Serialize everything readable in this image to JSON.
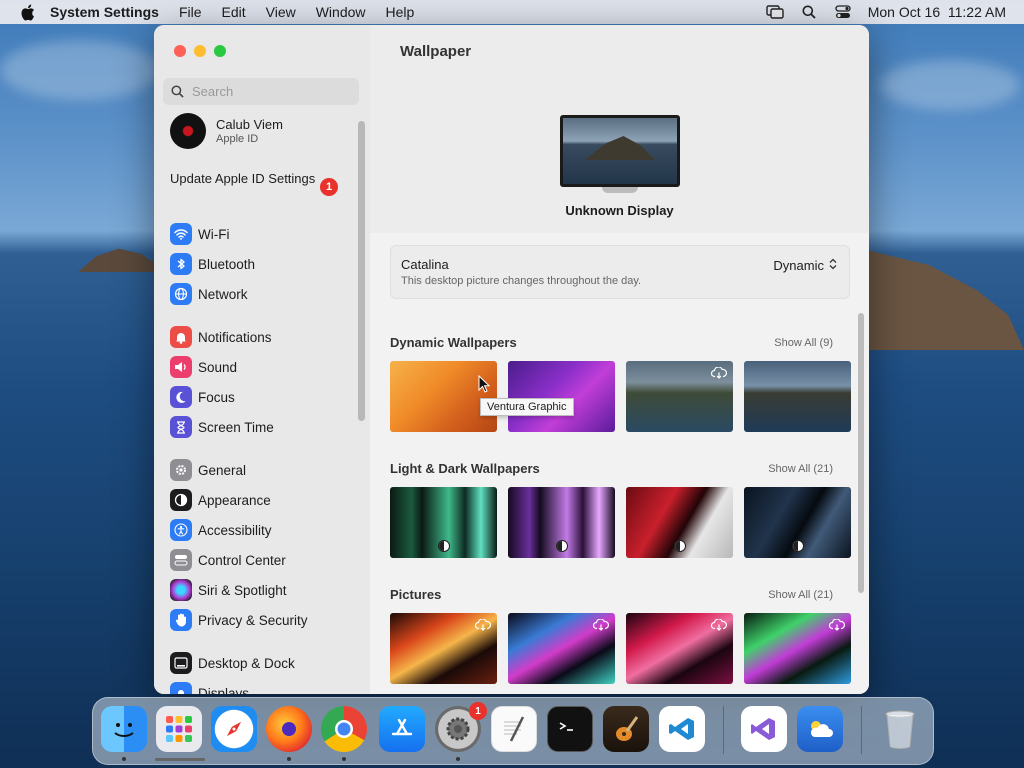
{
  "menubar": {
    "app_name": "System Settings",
    "menus": [
      "File",
      "Edit",
      "View",
      "Window",
      "Help"
    ],
    "datetime": "Mon Oct 16  11:22 AM"
  },
  "sidebar": {
    "search_placeholder": "Search",
    "account": {
      "name": "Calub Viem",
      "subtitle": "Apple ID"
    },
    "update": {
      "label": "Update Apple ID Settings",
      "badge": "1"
    },
    "items": [
      {
        "label": "Wi-Fi",
        "icon": "wifi-icon",
        "color": "#2d7cf6"
      },
      {
        "label": "Bluetooth",
        "icon": "bluetooth-icon",
        "color": "#2d7cf6"
      },
      {
        "label": "Network",
        "icon": "globe-icon",
        "color": "#2d7cf6"
      },
      {
        "label": "Notifications",
        "icon": "bell-icon",
        "color": "#ec4d47"
      },
      {
        "label": "Sound",
        "icon": "speaker-icon",
        "color": "#ec3e6d"
      },
      {
        "label": "Focus",
        "icon": "moon-icon",
        "color": "#5a52d6"
      },
      {
        "label": "Screen Time",
        "icon": "hourglass-icon",
        "color": "#5a52d6"
      },
      {
        "label": "General",
        "icon": "gear-icon",
        "color": "#8e8e93"
      },
      {
        "label": "Appearance",
        "icon": "appearance-icon",
        "color": "#1c1c1e"
      },
      {
        "label": "Accessibility",
        "icon": "accessibility-icon",
        "color": "#2d7cf6"
      },
      {
        "label": "Control Center",
        "icon": "control-center-icon",
        "color": "#8e8e93"
      },
      {
        "label": "Siri & Spotlight",
        "icon": "siri-icon",
        "color": "#a83ad6"
      },
      {
        "label": "Privacy & Security",
        "icon": "hand-icon",
        "color": "#2d7cf6"
      },
      {
        "label": "Desktop & Dock",
        "icon": "dock-icon",
        "color": "#1c1c1e"
      },
      {
        "label": "Displays",
        "icon": "display-icon",
        "color": "#2d7cf6"
      }
    ]
  },
  "content": {
    "title": "Wallpaper",
    "display_name": "Unknown Display",
    "current": {
      "name": "Catalina",
      "description": "This desktop picture changes throughout the day.",
      "mode": "Dynamic"
    },
    "sections": [
      {
        "title": "Dynamic Wallpapers",
        "show_all": "Show All (9)"
      },
      {
        "title": "Light & Dark Wallpapers",
        "show_all": "Show All (21)"
      },
      {
        "title": "Pictures",
        "show_all": "Show All (21)"
      }
    ],
    "tooltip": "Ventura Graphic"
  },
  "dock": {
    "apps": [
      "finder-icon",
      "launchpad-icon",
      "safari-icon",
      "firefox-icon",
      "chrome-icon",
      "app-store-icon",
      "system-settings-icon",
      "textedit-icon",
      "terminal-icon",
      "garageband-icon",
      "vscode-icon",
      "visual-studio-icon",
      "weather-icon",
      "trash-icon"
    ],
    "settings_badge": "1"
  }
}
